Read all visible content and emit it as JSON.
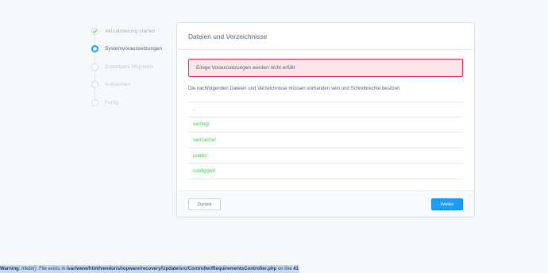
{
  "steps": [
    {
      "label": "Aktualisierung starten",
      "state": "done",
      "icon": "check-icon"
    },
    {
      "label": "Systemvoraussetzungen",
      "state": "active",
      "icon": "ring-icon"
    },
    {
      "label": "Datenbank-Migration",
      "state": "todo",
      "icon": "circle-icon"
    },
    {
      "label": "Aufräumen",
      "state": "todo",
      "icon": "circle-icon"
    },
    {
      "label": "Fertig",
      "state": "todo",
      "icon": "circle-icon"
    }
  ],
  "card": {
    "title": "Dateien und Verzeichnisse",
    "alert": "Einige Voraussetzungen werden nicht erfüllt",
    "intro": "Die nachfolgenden Dateien und Verzeichnisse müssen vorhanden sein und Schreibrechte besitzen",
    "paths": [
      ".",
      "var/log/",
      "var/cache/",
      "public/",
      "config/jwt/"
    ],
    "back_label": "Zurück",
    "next_label": "Weiter"
  },
  "warning": {
    "prefix": "Warning",
    "message": ": mkdir(): File exists in ",
    "path": "/var/www/html/vendor/shopware/recovery/Update/src/Controller/RequirementsController.php",
    "suffix": " on line ",
    "line": "41"
  },
  "colors": {
    "accent": "#189eff",
    "success": "#37d046",
    "error": "#de294c",
    "error_bg": "#fbe7ea"
  }
}
